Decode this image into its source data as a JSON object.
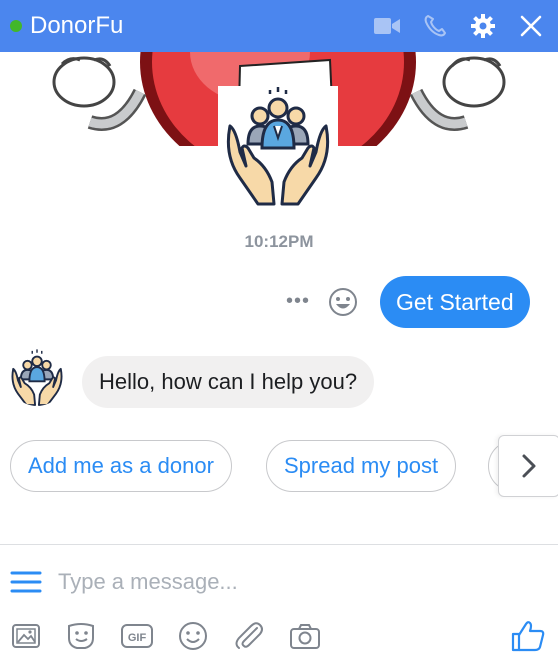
{
  "header": {
    "title": "DonorFu",
    "online": true,
    "icons": [
      "video-icon",
      "phone-icon",
      "gear-icon",
      "close-icon"
    ]
  },
  "conversation": {
    "timestamp": "10:12PM",
    "outgoing": {
      "text": "Get Started"
    },
    "incoming": {
      "text": "Hello, how can I help you?"
    },
    "more_label": "•••"
  },
  "quick_replies": [
    {
      "label": "Add me as a donor"
    },
    {
      "label": "Spread my post"
    }
  ],
  "composer": {
    "placeholder": "Type a message...",
    "tools": [
      "image-icon",
      "sticker-icon",
      "gif-icon",
      "emoji-icon",
      "attachment-icon",
      "camera-icon",
      "like-icon"
    ],
    "gif_label": "GIF"
  },
  "colors": {
    "accent": "#4b86ee",
    "bubble_out": "#2b8cf4",
    "bubble_in": "#f1f0f0",
    "online": "#42b72a"
  }
}
